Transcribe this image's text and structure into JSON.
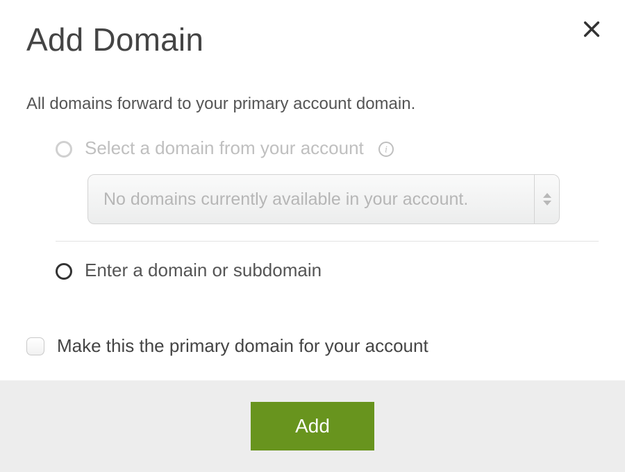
{
  "header": {
    "title": "Add Domain"
  },
  "description": "All domains forward to your primary account domain.",
  "options": {
    "select_from_account": {
      "label": "Select a domain from your account",
      "dropdown_placeholder": "No domains currently available in your account."
    },
    "enter_domain": {
      "label": "Enter a domain or subdomain"
    }
  },
  "checkbox": {
    "primary_label": "Make this the primary domain for your account"
  },
  "actions": {
    "submit": "Add"
  }
}
